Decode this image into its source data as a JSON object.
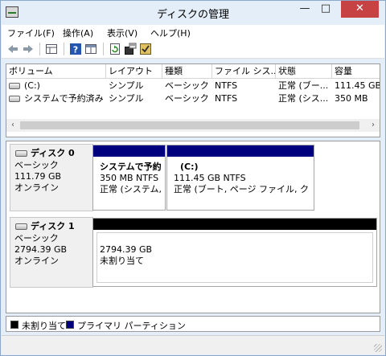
{
  "window": {
    "title": "ディスクの管理",
    "minimize": "—",
    "maximize": "□",
    "close": "✕"
  },
  "menu": [
    "ファイル(F)",
    "操作(A)",
    "表示(V)",
    "ヘルプ(H)"
  ],
  "toolbar": [
    "back-arrow-icon",
    "forward-arrow-icon",
    "grid-view-icon",
    "help-icon",
    "panel-view-icon",
    "refresh-icon",
    "properties-icon",
    "check-icon"
  ],
  "volume_list": {
    "columns": [
      "ボリューム",
      "レイアウト",
      "種類",
      "ファイル シス...",
      "状態",
      "容量"
    ],
    "rows": [
      {
        "volume": "(C:)",
        "layout": "シンプル",
        "type": "ベーシック",
        "fs": "NTFS",
        "status": "正常 (ブー...",
        "capacity": "111.45 GB"
      },
      {
        "volume": "システムで予約済み",
        "layout": "シンプル",
        "type": "ベーシック",
        "fs": "NTFS",
        "status": "正常 (シス...",
        "capacity": "350 MB"
      }
    ],
    "scroll_left": "‹",
    "scroll_right": "›"
  },
  "disks": [
    {
      "name": "ディスク 0",
      "type": "ベーシック",
      "size": "111.79 GB",
      "state": "オンライン",
      "partitions": [
        {
          "name": "システムで予約済",
          "size": "350 MB NTFS",
          "status": "正常 (システム, ア"
        },
        {
          "name": "(C:)",
          "size": "111.45 GB NTFS",
          "status": "正常 (ブート, ページ ファイル, クラッシュ"
        }
      ]
    },
    {
      "name": "ディスク 1",
      "type": "ベーシック",
      "size": "2794.39 GB",
      "state": "オンライン",
      "partitions": [
        {
          "name": "",
          "size": "2794.39 GB",
          "status": "未割り当て"
        }
      ]
    }
  ],
  "legend": [
    {
      "label": "未割り当て",
      "color": "#000000"
    },
    {
      "label": "プライマリ パーティション",
      "color": "#00007f"
    }
  ],
  "colors": {
    "primary_partition": "#00007f",
    "unallocated": "#000000",
    "close_button": "#c74242"
  }
}
